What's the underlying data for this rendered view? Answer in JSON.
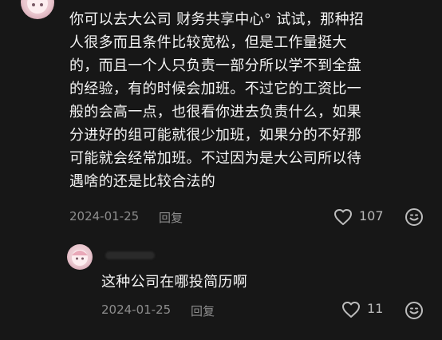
{
  "comment": {
    "lines": [
      "你可以去大公司 财务共享中心° 试试，那种招",
      "人很多而且条件比较宽松，但是工作量挺大",
      "的，而且一个人只负责一部分所以学不到全盘",
      "的经验，有的时候会加班。不过它的工资比一",
      "般的会高一点，也很看你进去负责什么，如果",
      "分进好的组可能就很少加班，如果分的不好那",
      "可能就会经常加班。不过因为是大公司所以待",
      "遇啥的还是比较合法的"
    ],
    "date": "2024-01-25",
    "reply_label": "回复",
    "like_count": "107"
  },
  "reply": {
    "text": "这种公司在哪投简历啊",
    "date": "2024-01-25",
    "reply_label": "回复",
    "like_count": "11"
  },
  "icons": {
    "like": "heart-outline-icon",
    "emoji": "smiley-icon"
  },
  "colors": {
    "background": "#171717",
    "primary_text": "#f4f4f4",
    "secondary_text": "#8d8d8d"
  }
}
